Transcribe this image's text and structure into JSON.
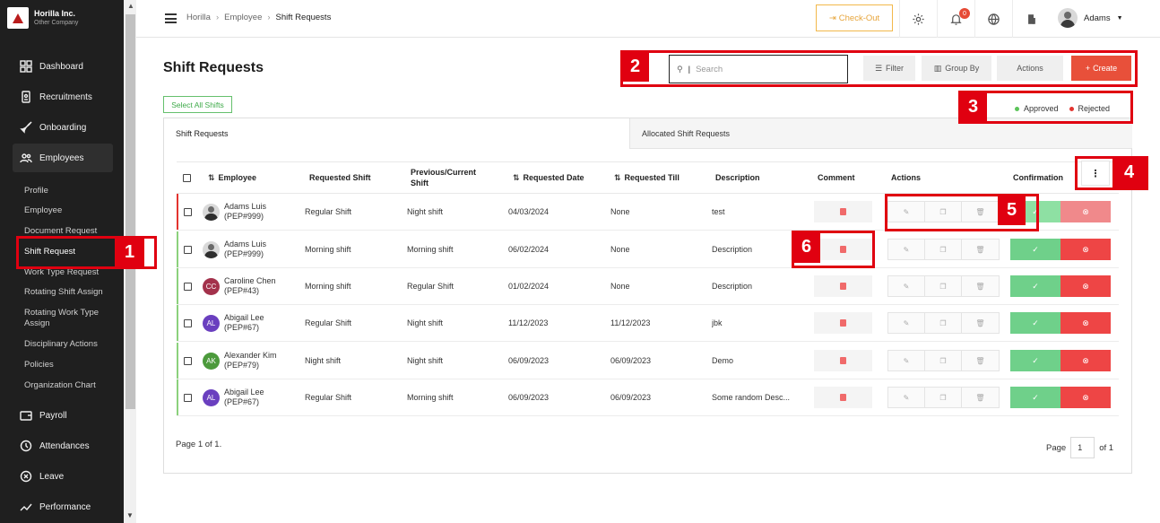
{
  "company": {
    "name": "Horilla Inc.",
    "subtitle": "Other Company"
  },
  "sidebar": {
    "nav": [
      {
        "label": "Dashboard",
        "icon": "dashboard-icon"
      },
      {
        "label": "Recruitments",
        "icon": "recruitment-icon"
      },
      {
        "label": "Onboarding",
        "icon": "rocket-icon"
      },
      {
        "label": "Employees",
        "icon": "people-icon"
      },
      {
        "label": "Payroll",
        "icon": "wallet-icon"
      },
      {
        "label": "Attendances",
        "icon": "clock-icon"
      },
      {
        "label": "Leave",
        "icon": "leave-icon"
      },
      {
        "label": "Performance",
        "icon": "trend-icon"
      }
    ],
    "employee_sub": [
      "Profile",
      "Employee",
      "Document Request",
      "Shift Request",
      "Work Type Request",
      "Rotating Shift Assign",
      "Rotating Work Type Assign",
      "Disciplinary Actions",
      "Policies",
      "Organization Chart"
    ]
  },
  "header": {
    "breadcrumb": [
      "Horilla",
      "Employee",
      "Shift Requests"
    ],
    "checkout_label": "Check-Out",
    "notification_count": "0",
    "user_name": "Adams"
  },
  "page": {
    "title": "Shift Requests",
    "search_placeholder": "Search",
    "filter_label": "Filter",
    "group_by_label": "Group By",
    "actions_label": "Actions",
    "create_label": "Create",
    "select_all_label": "Select All Shifts",
    "legend": [
      {
        "label": "Approved",
        "color": "#5cc45a"
      },
      {
        "label": "Rejected",
        "color": "#e3342f"
      }
    ],
    "tabs": [
      "Shift Requests",
      "Allocated Shift Requests"
    ]
  },
  "table": {
    "headers": [
      "Employee",
      "Requested Shift",
      "Previous/Current Shift",
      "Requested Date",
      "Requested Till",
      "Description",
      "Comment",
      "Actions",
      "Confirmation"
    ],
    "rows": [
      {
        "name": "Adams Luis",
        "code": "(PEP#999)",
        "avatar": "",
        "avatar_color": "",
        "requested": "Regular Shift",
        "previous": "Night shift",
        "date": "04/03/2024",
        "till": "None",
        "description": "test",
        "status_color": "#e3342f"
      },
      {
        "name": "Adams Luis",
        "code": "(PEP#999)",
        "avatar": "",
        "avatar_color": "",
        "requested": "Morning shift",
        "previous": "Morning shift",
        "date": "06/02/2024",
        "till": "None",
        "description": "Description",
        "status_color": "#8bd17c"
      },
      {
        "name": "Caroline Chen",
        "code": "(PEP#43)",
        "avatar": "CC",
        "avatar_color": "#a3314b",
        "requested": "Morning shift",
        "previous": "Regular Shift",
        "date": "01/02/2024",
        "till": "None",
        "description": "Description",
        "status_color": "#8bd17c"
      },
      {
        "name": "Abigail Lee",
        "code": "(PEP#67)",
        "avatar": "AL",
        "avatar_color": "#6a3fbf",
        "requested": "Regular Shift",
        "previous": "Night shift",
        "date": "11/12/2023",
        "till": "11/12/2023",
        "description": "jbk",
        "status_color": "#8bd17c"
      },
      {
        "name": "Alexander Kim",
        "code": "(PEP#79)",
        "avatar": "AK",
        "avatar_color": "#4c9a3c",
        "requested": "Night shift",
        "previous": "Night shift",
        "date": "06/09/2023",
        "till": "06/09/2023",
        "description": "Demo",
        "status_color": "#8bd17c"
      },
      {
        "name": "Abigail Lee",
        "code": "(PEP#67)",
        "avatar": "AL",
        "avatar_color": "#6a3fbf",
        "requested": "Regular Shift",
        "previous": "Morning shift",
        "date": "06/09/2023",
        "till": "06/09/2023",
        "description": "Some random Desc...",
        "status_color": "#8bd17c"
      }
    ]
  },
  "pagination": {
    "summary": "Page 1 of 1.",
    "page_label": "Page",
    "current": "1",
    "of_label": "of 1"
  },
  "annotations": [
    "1",
    "2",
    "3",
    "4",
    "5",
    "6"
  ]
}
